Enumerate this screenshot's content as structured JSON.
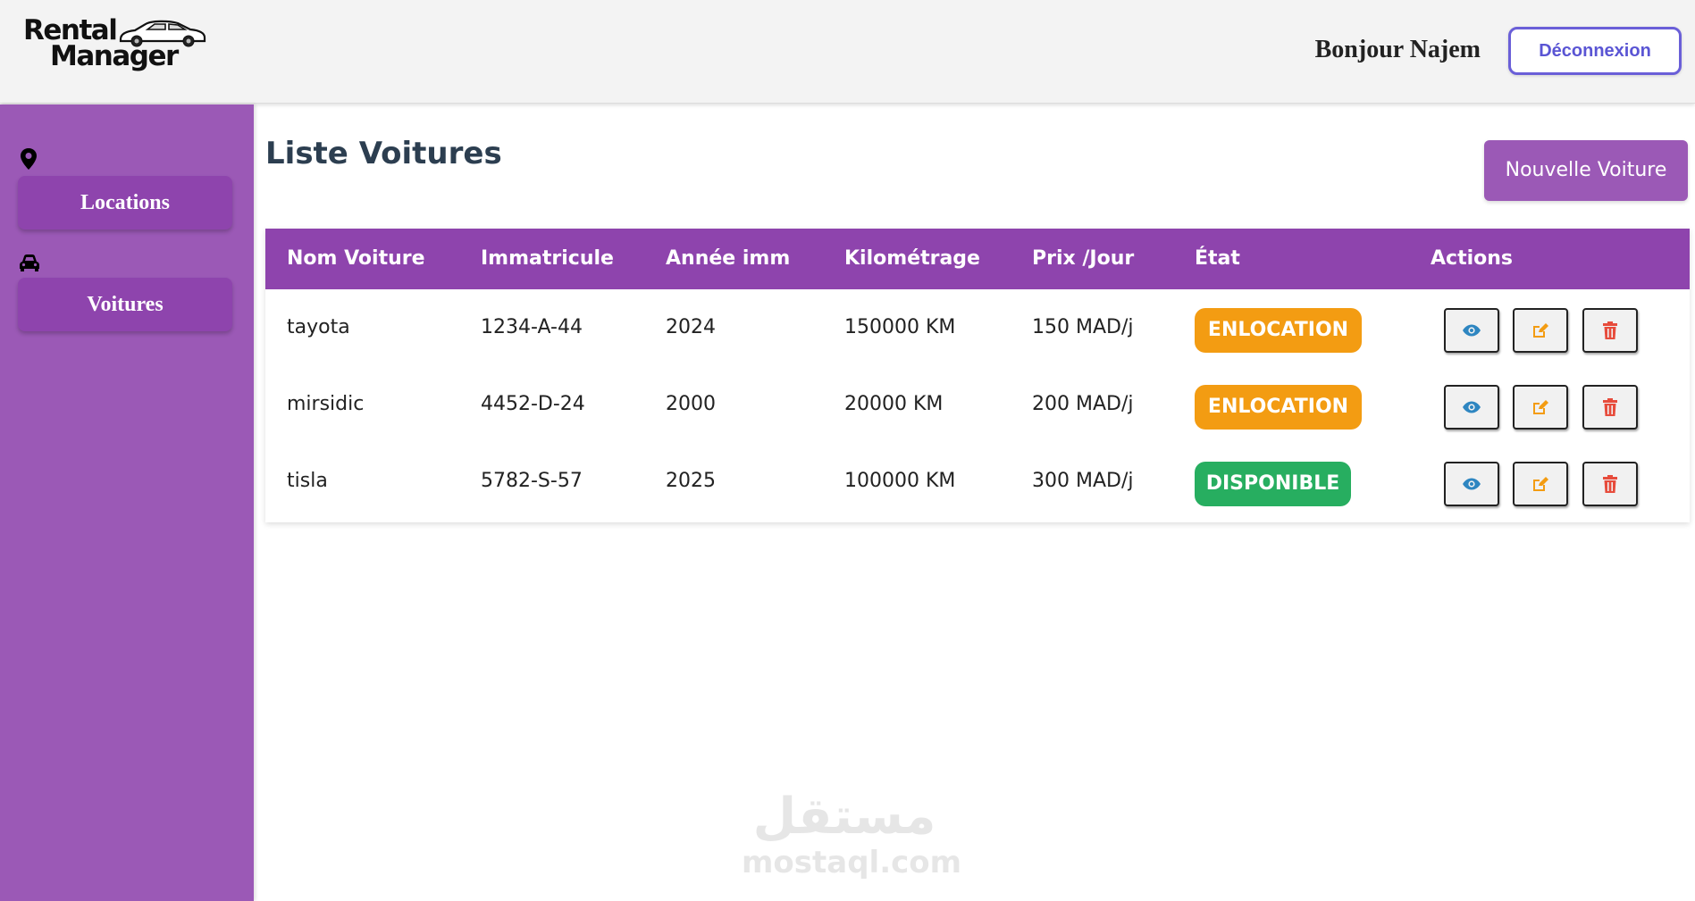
{
  "header": {
    "logo_line1": "Rental",
    "logo_line2": "Manager",
    "greeting": "Bonjour Najem",
    "logout_label": "Déconnexion"
  },
  "sidebar": {
    "items": [
      {
        "label": "Locations",
        "icon": "map-marker-icon"
      },
      {
        "label": "Voitures",
        "icon": "car-icon"
      }
    ]
  },
  "main": {
    "title": "Liste Voitures",
    "new_car_label": "Nouvelle Voiture",
    "table": {
      "columns": [
        "Nom Voiture",
        "Immatricule",
        "Année imm",
        "Kilométrage",
        "Prix /Jour",
        "État",
        "Actions"
      ],
      "rows": [
        {
          "nom": "tayota",
          "immatricule": "1234-A-44",
          "annee": "2024",
          "kilometrage": "150000 KM",
          "prix": "150 MAD/j",
          "etat": "ENLOCATION",
          "etat_color": "#f39c12"
        },
        {
          "nom": "mirsidic",
          "immatricule": "4452-D-24",
          "annee": "2000",
          "kilometrage": "20000 KM",
          "prix": "200 MAD/j",
          "etat": "ENLOCATION",
          "etat_color": "#f39c12"
        },
        {
          "nom": "tisla",
          "immatricule": "5782-S-57",
          "annee": "2025",
          "kilometrage": "100000 KM",
          "prix": "300 MAD/j",
          "etat": "DISPONIBLE",
          "etat_color": "#27ae60"
        }
      ],
      "action_icons": [
        "eye-icon",
        "edit-icon",
        "trash-icon"
      ]
    }
  },
  "watermark": {
    "arabic": "مستقل",
    "latin": "mostaql.com"
  },
  "colors": {
    "sidebar": "#9b59b6",
    "accent": "#8e44ad",
    "logout": "#5a55d4",
    "view": "#2e86c1",
    "edit": "#f39c12",
    "delete": "#e74c3c"
  }
}
